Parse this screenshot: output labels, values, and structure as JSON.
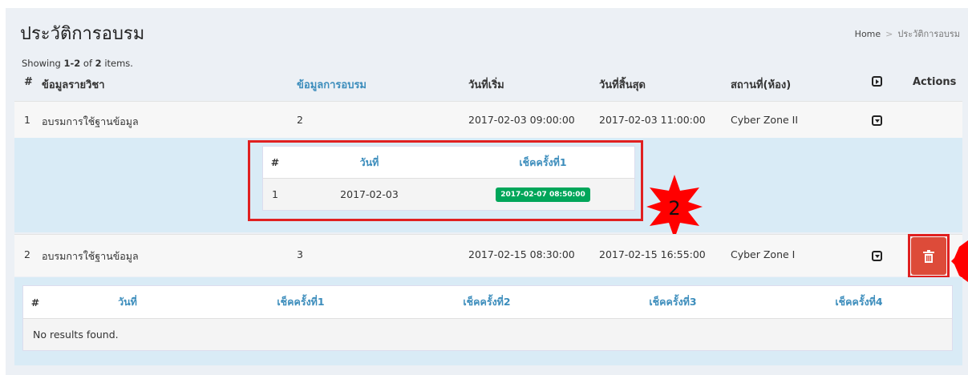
{
  "page": {
    "title": "ประวัติการอบรม",
    "breadcrumb": {
      "home": "Home",
      "separator": ">",
      "current": "ประวัติการอบรม"
    },
    "summary": {
      "prefix": "Showing ",
      "range": "1-2",
      "mid": " of ",
      "total": "2",
      "suffix": " items."
    }
  },
  "table": {
    "headers": {
      "num": "#",
      "course": "ข้อมูลรายวิชา",
      "training": "ข้อมูลการอบรม",
      "start": "วันที่เริ่ม",
      "end": "วันที่สิ้นสุด",
      "place": "สถานที่(ห้อง)",
      "actions": "Actions"
    },
    "rows": [
      {
        "num": "1",
        "course": "อบรมการใช้ฐานข้อมูล",
        "training": "2",
        "start": "2017-02-03 09:00:00",
        "end": "2017-02-03 11:00:00",
        "place": "Cyber Zone II"
      },
      {
        "num": "2",
        "course": "อบรมการใช้ฐานข้อมูล",
        "training": "3",
        "start": "2017-02-15 08:30:00",
        "end": "2017-02-15 16:55:00",
        "place": "Cyber Zone I"
      }
    ]
  },
  "detail1": {
    "headers": {
      "num": "#",
      "date": "วันที่",
      "check1": "เช็คครั้งที่1"
    },
    "rows": [
      {
        "num": "1",
        "date": "2017-02-03",
        "check1": "2017-02-07 08:50:00"
      }
    ]
  },
  "detail2": {
    "headers": {
      "num": "#",
      "date": "วันที่",
      "check1": "เช็คครั้งที่1",
      "check2": "เช็คครั้งที่2",
      "check3": "เช็คครั้งที่3",
      "check4": "เช็คครั้งที่4"
    },
    "empty": "No results found."
  },
  "annotations": {
    "marker": "2"
  },
  "colors": {
    "accent": "#3c8dbc",
    "danger": "#dd4b39",
    "success": "#00a65a",
    "highlight": "#e02020",
    "marker": "#ff0000"
  }
}
